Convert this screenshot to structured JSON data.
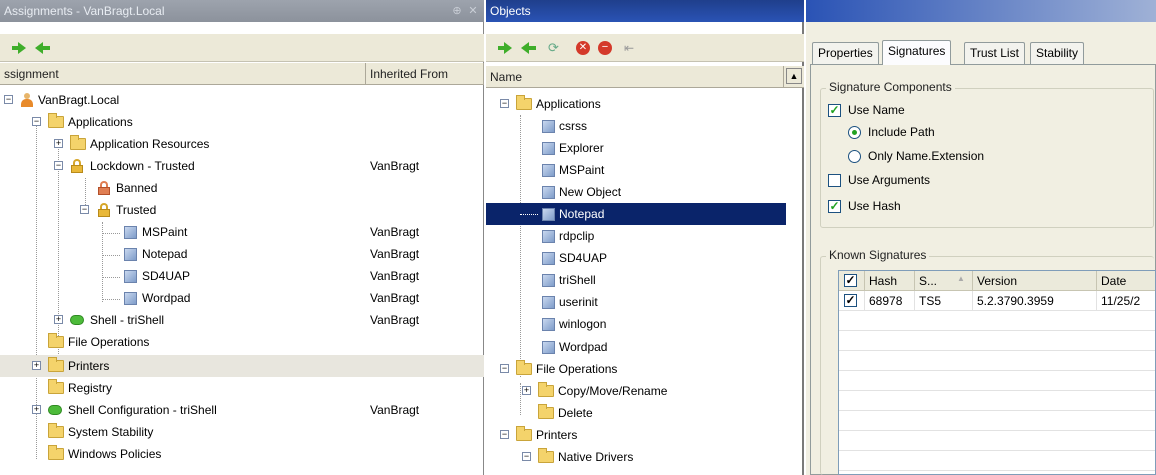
{
  "left_panel": {
    "title": "Assignments - VanBragt.Local",
    "columns": [
      "ssignment",
      "Inherited From"
    ],
    "rows": [
      {
        "label": "VanBragt.Local",
        "inherited": ""
      },
      {
        "label": "Applications",
        "inherited": ""
      },
      {
        "label": "Application Resources",
        "inherited": ""
      },
      {
        "label": "Lockdown - Trusted",
        "inherited": "VanBragt"
      },
      {
        "label": "Banned",
        "inherited": ""
      },
      {
        "label": "Trusted",
        "inherited": ""
      },
      {
        "label": "MSPaint",
        "inherited": "VanBragt"
      },
      {
        "label": "Notepad",
        "inherited": "VanBragt"
      },
      {
        "label": "SD4UAP",
        "inherited": "VanBragt"
      },
      {
        "label": "Wordpad",
        "inherited": "VanBragt"
      },
      {
        "label": "Shell - triShell",
        "inherited": "VanBragt"
      },
      {
        "label": "File Operations",
        "inherited": ""
      },
      {
        "label": "Printers",
        "inherited": ""
      },
      {
        "label": "Registry",
        "inherited": ""
      },
      {
        "label": "Shell Configuration - triShell",
        "inherited": "VanBragt"
      },
      {
        "label": "System Stability",
        "inherited": ""
      },
      {
        "label": "Windows Policies",
        "inherited": ""
      }
    ]
  },
  "middle_panel": {
    "title": "Objects",
    "column": "Name",
    "rows": [
      {
        "label": "Applications"
      },
      {
        "label": "csrss"
      },
      {
        "label": "Explorer"
      },
      {
        "label": "MSPaint"
      },
      {
        "label": "New Object"
      },
      {
        "label": "Notepad"
      },
      {
        "label": "rdpclip"
      },
      {
        "label": "SD4UAP"
      },
      {
        "label": "triShell"
      },
      {
        "label": "userinit"
      },
      {
        "label": "winlogon"
      },
      {
        "label": "Wordpad"
      },
      {
        "label": "File Operations"
      },
      {
        "label": "Copy/Move/Rename"
      },
      {
        "label": "Delete"
      },
      {
        "label": "Printers"
      },
      {
        "label": "Native Drivers"
      }
    ]
  },
  "right_panel": {
    "tabs": [
      "Properties",
      "Signatures",
      "Trust List",
      "Stability"
    ],
    "active_tab": "Signatures",
    "signature_components": {
      "title": "Signature Components",
      "use_name": "Use Name",
      "use_name_checked": true,
      "include_path": "Include Path",
      "only_name_ext": "Only Name.Extension",
      "use_arguments": "Use Arguments",
      "use_arguments_checked": false,
      "use_hash": "Use Hash",
      "use_hash_checked": true
    },
    "known_signatures": {
      "title": "Known Signatures",
      "columns": [
        "Hash",
        "S...",
        "Version",
        "Date"
      ],
      "rows": [
        {
          "hash": "68978",
          "s": "TS5",
          "version": "5.2.3790.3959",
          "date": "11/25/2"
        }
      ]
    }
  },
  "colors": {
    "selection": "#0a246a",
    "active_title": "#2a53b5",
    "toolbar": "#ece9d8",
    "check": "#21a121"
  }
}
